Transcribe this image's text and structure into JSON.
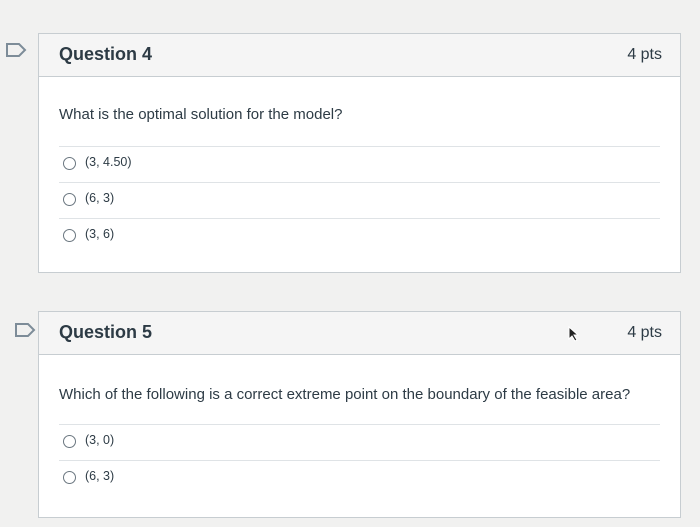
{
  "questions": [
    {
      "title": "Question 4",
      "points": "4 pts",
      "text": "What is the optimal solution for the model?",
      "answers": [
        "(3, 4.50)",
        "(6, 3)",
        "(3, 6)"
      ]
    },
    {
      "title": "Question 5",
      "points": "4 pts",
      "text": "Which of the following is a correct extreme point on the boundary of the feasible area?",
      "answers": [
        "(3, 0)",
        "(6, 3)"
      ]
    }
  ],
  "icons": {
    "flag": "flag-icon",
    "radio": "radio-icon",
    "cursor": "cursor-icon"
  },
  "colors": {
    "flag_stroke": "#7d8c98",
    "header_bg": "#f5f5f5",
    "border": "#c7cdd1",
    "text": "#2d3b45"
  }
}
